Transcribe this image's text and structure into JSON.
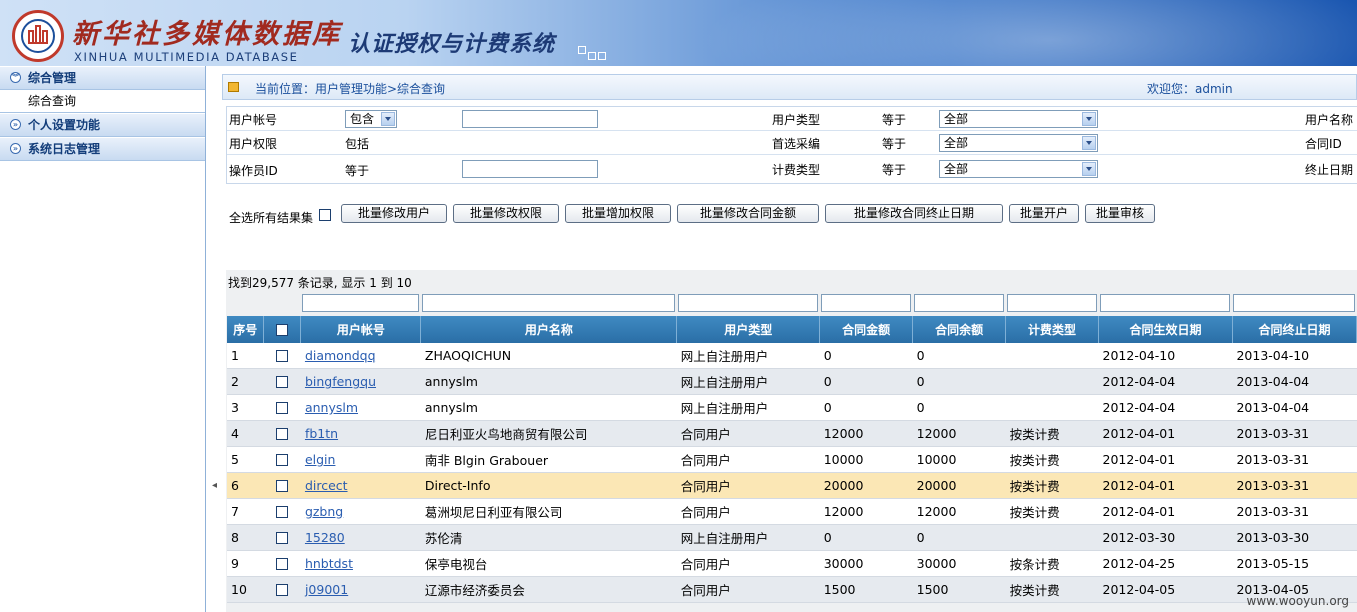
{
  "header": {
    "title_cn": "新华社多媒体数据库",
    "title_en": "XINHUA MULTIMEDIA DATABASE",
    "subtitle": "认证授权与计费系统",
    "logo_text": "XINHUA"
  },
  "sidebar": {
    "items": [
      {
        "label": "综合管理",
        "children": [
          "综合查询"
        ]
      },
      {
        "label": "个人设置功能"
      },
      {
        "label": "系统日志管理"
      }
    ]
  },
  "location": {
    "label": "当前位置：用户管理功能>综合查询",
    "welcome": "欢迎您：admin"
  },
  "filters": {
    "row1": {
      "a_label": "用户帐号",
      "a_select": "包含",
      "b_label": "用户类型",
      "b_op": "等于",
      "b_select": "全部",
      "c_label": "用户名称"
    },
    "row2": {
      "a_label": "用户权限",
      "a_op": "包括",
      "b_label": "首选采编",
      "b_op": "等于",
      "b_select": "全部",
      "c_label": "合同ID"
    },
    "row3": {
      "a_label": "操作员ID",
      "a_op": "等于",
      "b_label": "计费类型",
      "b_op": "等于",
      "b_select": "全部",
      "c_label": "终止日期"
    }
  },
  "batch": {
    "select_all_label": "全选所有结果集",
    "buttons": [
      "批量修改用户",
      "批量修改权限",
      "批量增加权限",
      "批量修改合同金额",
      "批量修改合同终止日期",
      "批量开户",
      "批量审核"
    ]
  },
  "results": {
    "summary": "找到29,577 条记录, 显示 1 到 10",
    "columns": [
      "序号",
      "",
      "用户帐号",
      "用户名称",
      "用户类型",
      "合同金额",
      "合同余额",
      "计费类型",
      "合同生效日期",
      "合同终止日期"
    ],
    "rows": [
      {
        "no": "1",
        "account": "diamondqq",
        "name": "ZHAOQICHUN",
        "type": "网上自注册用户",
        "amount": "0",
        "balance": "0",
        "billing": "",
        "start": "2012-04-10",
        "end": "2013-04-10"
      },
      {
        "no": "2",
        "account": "bingfengqu",
        "name": "annyslm",
        "type": "网上自注册用户",
        "amount": "0",
        "balance": "0",
        "billing": "",
        "start": "2012-04-04",
        "end": "2013-04-04"
      },
      {
        "no": "3",
        "account": "annyslm",
        "name": "annyslm",
        "type": "网上自注册用户",
        "amount": "0",
        "balance": "0",
        "billing": "",
        "start": "2012-04-04",
        "end": "2013-04-04"
      },
      {
        "no": "4",
        "account": "fb1tn",
        "name": "尼日利亚火鸟地商贸有限公司",
        "type": "合同用户",
        "amount": "12000",
        "balance": "12000",
        "billing": "按类计费",
        "start": "2012-04-01",
        "end": "2013-03-31"
      },
      {
        "no": "5",
        "account": "elgin",
        "name": "南非 Blgin Grabouer",
        "type": "合同用户",
        "amount": "10000",
        "balance": "10000",
        "billing": "按类计费",
        "start": "2012-04-01",
        "end": "2013-03-31"
      },
      {
        "no": "6",
        "account": "dircect",
        "name": "Direct-Info",
        "type": "合同用户",
        "amount": "20000",
        "balance": "20000",
        "billing": "按类计费",
        "start": "2012-04-01",
        "end": "2013-03-31"
      },
      {
        "no": "7",
        "account": "gzbng",
        "name": "葛洲坝尼日利亚有限公司",
        "type": "合同用户",
        "amount": "12000",
        "balance": "12000",
        "billing": "按类计费",
        "start": "2012-04-01",
        "end": "2013-03-31"
      },
      {
        "no": "8",
        "account": "15280",
        "name": "苏伦清",
        "type": "网上自注册用户",
        "amount": "0",
        "balance": "0",
        "billing": "",
        "start": "2012-03-30",
        "end": "2013-03-30"
      },
      {
        "no": "9",
        "account": "hnbtdst",
        "name": "保亭电视台",
        "type": "合同用户",
        "amount": "30000",
        "balance": "30000",
        "billing": "按条计费",
        "start": "2012-04-25",
        "end": "2013-05-15"
      },
      {
        "no": "10",
        "account": "j09001",
        "name": "辽源市经济委员会",
        "type": "合同用户",
        "amount": "1500",
        "balance": "1500",
        "billing": "按类计费",
        "start": "2012-04-05",
        "end": "2013-04-05"
      }
    ]
  },
  "watermark": "www.wooyun.org"
}
